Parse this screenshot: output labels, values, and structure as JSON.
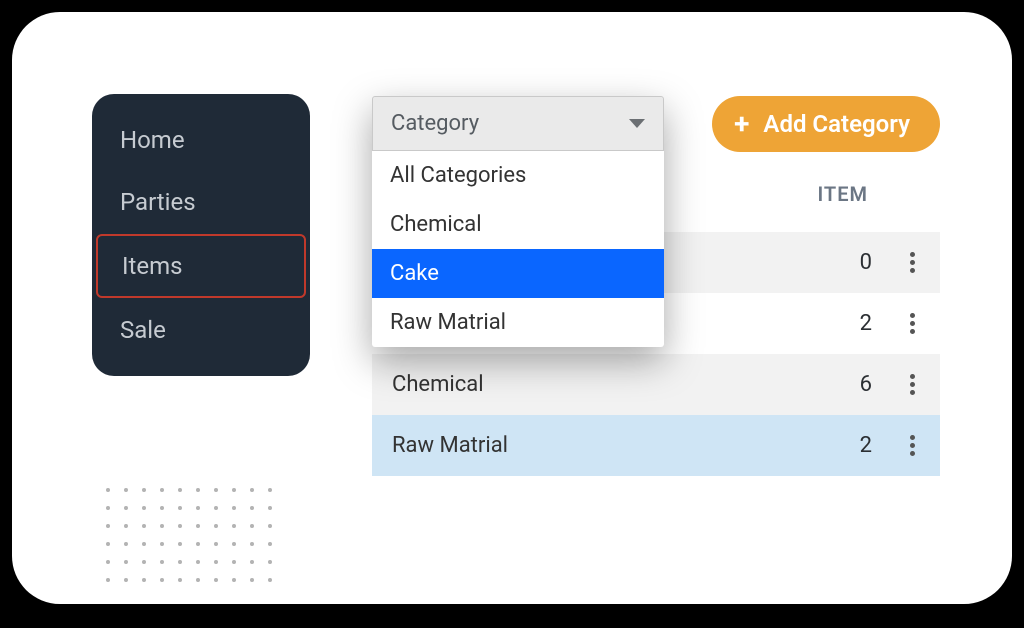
{
  "sidebar": {
    "items": [
      {
        "label": "Home",
        "active": false
      },
      {
        "label": "Parties",
        "active": false
      },
      {
        "label": "Items",
        "active": true
      },
      {
        "label": "Sale",
        "active": false
      }
    ]
  },
  "dropdown": {
    "label": "Category",
    "options": [
      {
        "label": "All Categories",
        "selected": false
      },
      {
        "label": "Chemical",
        "selected": false
      },
      {
        "label": "Cake",
        "selected": true
      },
      {
        "label": "Raw Matrial",
        "selected": false
      }
    ]
  },
  "add_button": {
    "label": "Add Category"
  },
  "table": {
    "header": "ITEM",
    "rows": [
      {
        "label": "",
        "value": 0,
        "highlight": false
      },
      {
        "label": "",
        "value": 2,
        "highlight": false
      },
      {
        "label": "Chemical",
        "value": 6,
        "highlight": false
      },
      {
        "label": "Raw Matrial",
        "value": 2,
        "highlight": true
      }
    ]
  }
}
